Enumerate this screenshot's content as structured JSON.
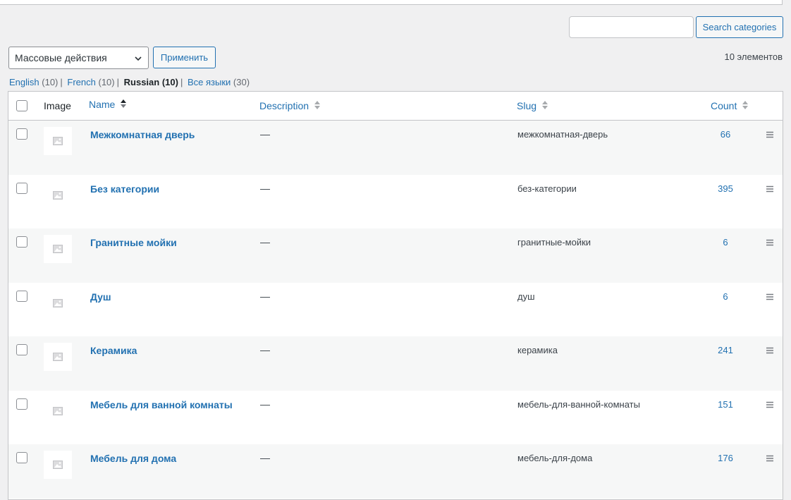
{
  "search": {
    "placeholder": "",
    "button_label": "Search categories"
  },
  "bulk_actions": {
    "selected": "Массовые действия",
    "apply_label": "Применить"
  },
  "items_count": "10 элементов",
  "language_filter": [
    {
      "label": "English",
      "count": "(10)",
      "current": false
    },
    {
      "label": "French",
      "count": "(10)",
      "current": false
    },
    {
      "label": "Russian",
      "count": "(10)",
      "current": true
    },
    {
      "label": "Все языки",
      "count": "(30)",
      "current": false
    }
  ],
  "table": {
    "columns": {
      "image": "Image",
      "name": "Name",
      "description": "Description",
      "slug": "Slug",
      "count": "Count"
    },
    "rows": [
      {
        "name": "Межкомнатная дверь",
        "description": "—",
        "slug": "межкомнатная-дверь",
        "count": "66"
      },
      {
        "name": "Без категории",
        "description": "—",
        "slug": "без-категории",
        "count": "395"
      },
      {
        "name": "Гранитные мойки",
        "description": "—",
        "slug": "гранитные-мойки",
        "count": "6"
      },
      {
        "name": "Душ",
        "description": "—",
        "slug": "душ",
        "count": "6"
      },
      {
        "name": "Керамика",
        "description": "—",
        "slug": "керамика",
        "count": "241"
      },
      {
        "name": "Мебель для ванной комнаты",
        "description": "—",
        "slug": "мебель-для-ванной-комнаты",
        "count": "151"
      },
      {
        "name": "Мебель для дома",
        "description": "—",
        "slug": "мебель-для-дома",
        "count": "176"
      }
    ]
  },
  "colors": {
    "link": "#2271b1",
    "text": "#3c434a",
    "row_alt": "#f6f7f7",
    "background": "#f0f0f1"
  },
  "icons": {
    "thumbnail": "image-placeholder-icon",
    "sort": "sort-arrows-icon",
    "drag": "drag-handle-icon",
    "dropdown": "chevron-down-icon"
  }
}
